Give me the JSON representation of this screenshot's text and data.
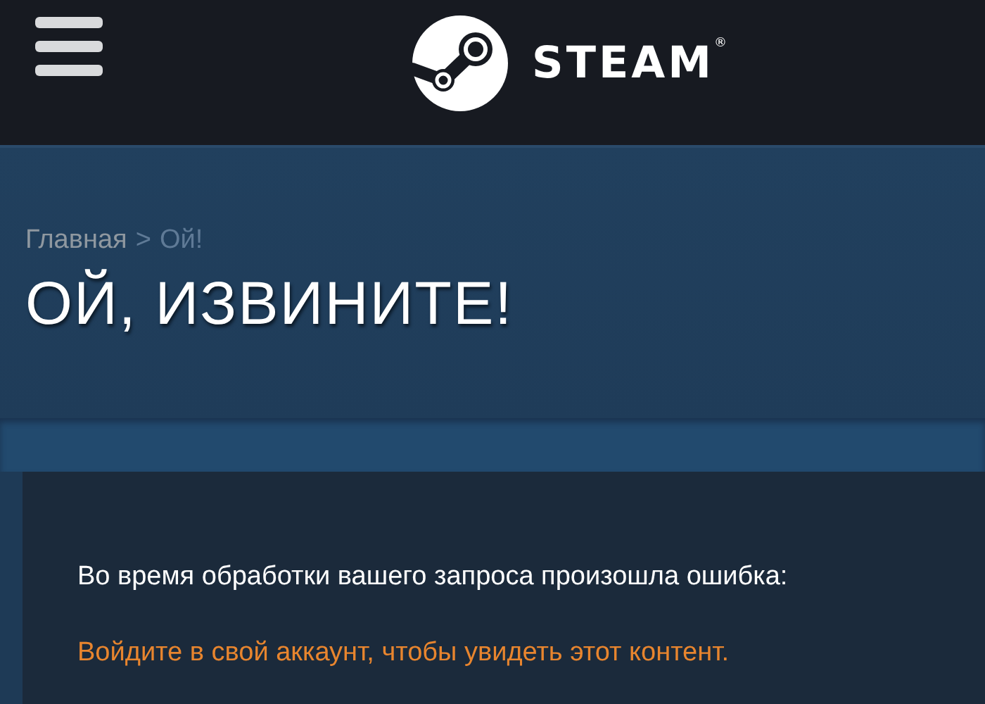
{
  "header": {
    "logo_text": "STEAM$^{®}$"
  },
  "breadcrumb": {
    "items": [
      "Главная",
      "Ой!"
    ],
    "separator": ">"
  },
  "title": "ОЙ, ИЗВИНИТЕ!",
  "error": {
    "message": "Во время обработки вашего запроса произошла ошибка:",
    "login_link": "Войдите в свой аккаунт, чтобы увидеть этот контент."
  }
}
